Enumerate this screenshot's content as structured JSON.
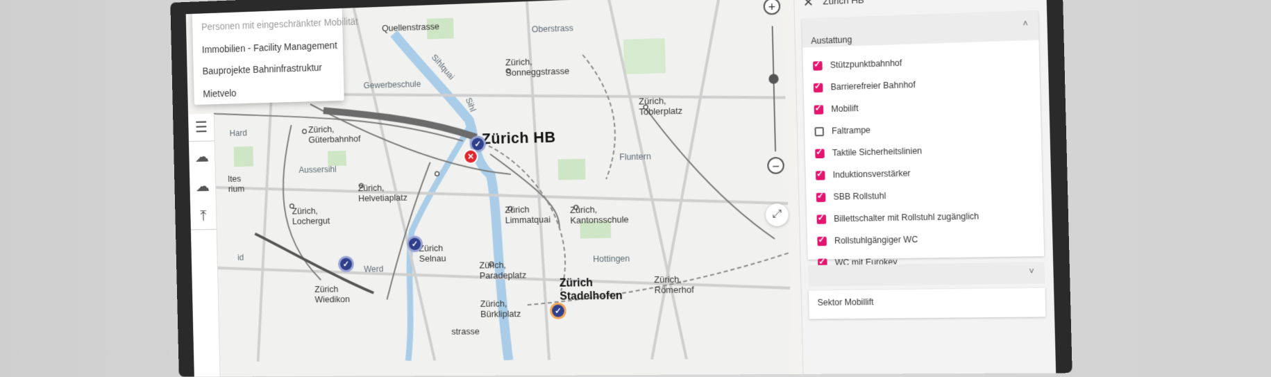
{
  "menu": {
    "items": [
      {
        "label": "Personen mit eingeschränkter Mobilität",
        "disabled": true
      },
      {
        "label": "Immobilien - Facility Management",
        "disabled": false
      },
      {
        "label": "Bauprojekte Bahninfrastruktur",
        "disabled": false
      },
      {
        "label": "Mietvelo",
        "disabled": false
      }
    ]
  },
  "toolbar": {
    "icons": [
      "list-icon",
      "cloud-download-icon",
      "cloud-upload-icon",
      "upload-top-icon"
    ]
  },
  "map": {
    "labels": {
      "quellenstrasse": "Quellenstrasse",
      "oberstrass": "Oberstrass",
      "sonneggstrasse": "Zürich,\nSonneggstrasse",
      "gewerbeschule": "Gewerbeschule",
      "sihlquai": "Sihlquai",
      "sihl": "Sihl",
      "hard": "Hard",
      "gueterbahnhof": "Zürich,\nGüterbahnhof",
      "hb": "Zürich HB",
      "toblerplatz": "Zürich,\nToblerplatz",
      "aussersihl": "Aussersihl",
      "fluntern": "Fluntern",
      "altes": "ltes\nrium",
      "helvetiaplatz": "Zürich,\nHelvetiaplatz",
      "limmatquai": "Zürich\nLimmatquai",
      "kantonsschule": "Zürich,\nKantonsschule",
      "lochergut": "Zürich,\nLochergut",
      "selnau": "Zürich\nSelnau",
      "werd": "Werd",
      "paradeplatz": "Zürich,\nParadeplatz",
      "hottingen": "Hottingen",
      "wiedikon": "Zürich\nWiedikon",
      "stadelhofen": "Zürich\nStadelhofen",
      "roemerhof": "Zürich,\nRömerhof",
      "buerkliplatz": "Zürich,\nBürkliplatz",
      "id": "id",
      "strasse_bottom": "strasse"
    }
  },
  "zoom": {
    "plus": "+",
    "minus": "−"
  },
  "panel": {
    "title": "Zürich HB",
    "section_title": "Austattung",
    "items": [
      {
        "label": "Stützpunktbahnhof",
        "checked": true
      },
      {
        "label": "Barrierefreier Bahnhof",
        "checked": true
      },
      {
        "label": "Mobilift",
        "checked": true
      },
      {
        "label": "Faltrampe",
        "checked": false
      },
      {
        "label": "Taktile Sicherheitslinien",
        "checked": true
      },
      {
        "label": "Induktionsverstärker",
        "checked": true
      },
      {
        "label": "SBB Rollstuhl",
        "checked": true
      },
      {
        "label": "Billettschalter mit Rollstuhl zugänglich",
        "checked": true
      },
      {
        "label": "Rollstuhlgängiger WC",
        "checked": true
      },
      {
        "label": "WC mit Eurokey",
        "checked": true
      }
    ],
    "next_section_title": "Sektor Mobillift"
  },
  "colors": {
    "accent": "#e4156f",
    "marker": "#2f3f8c",
    "error": "#e0242d",
    "water": "#a9cde8",
    "park": "#cfe6c6"
  }
}
